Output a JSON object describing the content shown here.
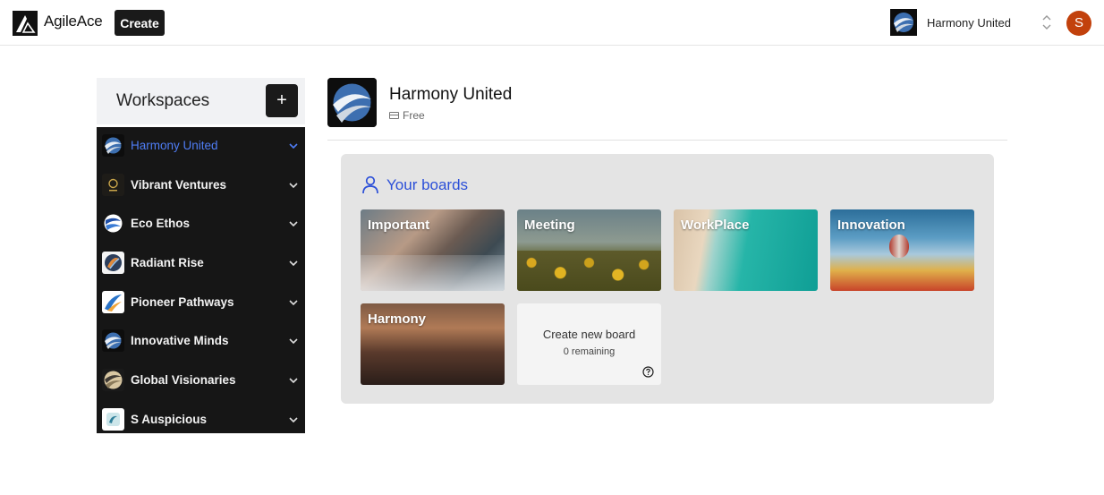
{
  "app": {
    "name": "AgileAce",
    "create_label": "Create"
  },
  "header": {
    "current_workspace": "Harmony United",
    "avatar_initial": "S",
    "avatar_color": "#c2410c"
  },
  "sidebar": {
    "title": "Workspaces",
    "add_label": "+",
    "items": [
      {
        "label": "Harmony United",
        "active": true,
        "icon": "harmony-logo-icon"
      },
      {
        "label": "Vibrant Ventures",
        "active": false,
        "icon": "vibrant-logo-icon"
      },
      {
        "label": "Eco Ethos",
        "active": false,
        "icon": "eco-logo-icon"
      },
      {
        "label": "Radiant Rise",
        "active": false,
        "icon": "radiant-logo-icon"
      },
      {
        "label": "Pioneer Pathways",
        "active": false,
        "icon": "pioneer-logo-icon"
      },
      {
        "label": "Innovative Minds",
        "active": false,
        "icon": "innovative-logo-icon"
      },
      {
        "label": "Global Visionaries",
        "active": false,
        "icon": "global-logo-icon"
      },
      {
        "label": "S Auspicious",
        "active": false,
        "icon": "auspicious-logo-icon"
      }
    ]
  },
  "main": {
    "org_name": "Harmony United",
    "plan": "Free",
    "boards_title": "Your boards",
    "boards": [
      {
        "title": "Important"
      },
      {
        "title": "Meeting"
      },
      {
        "title": "WorkPlace"
      },
      {
        "title": "Innovation"
      },
      {
        "title": "Harmony"
      }
    ],
    "create_board": {
      "title": "Create new board",
      "remaining": "0 remaining"
    }
  },
  "colors": {
    "accent": "#2b4fd8",
    "active_item": "#4f7df5",
    "sidebar_bg": "#161616"
  }
}
